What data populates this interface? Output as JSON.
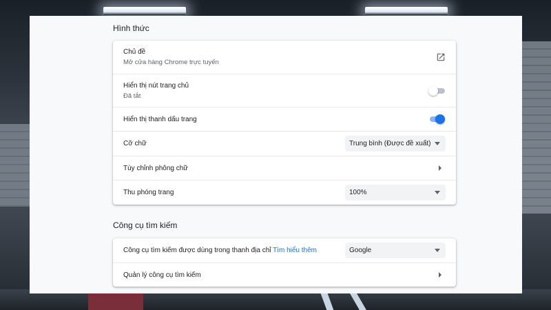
{
  "appearance": {
    "title": "Hình thức",
    "theme": {
      "label": "Chủ đề",
      "sublabel": "Mở cửa hàng Chrome trực tuyến",
      "icon": "external-link-icon"
    },
    "home_button": {
      "label": "Hiển thị nút trang chủ",
      "sublabel": "Đã tắt",
      "enabled": false
    },
    "bookmarks_bar": {
      "label": "Hiển thị thanh dấu trang",
      "enabled": true
    },
    "font_size": {
      "label": "Cỡ chữ",
      "value": "Trung bình (Được đề xuất)"
    },
    "customize_fonts": {
      "label": "Tùy chỉnh phông chữ"
    },
    "page_zoom": {
      "label": "Thu phóng trang",
      "value": "100%"
    }
  },
  "search_engine": {
    "title": "Công cụ tìm kiếm",
    "engine": {
      "label": "Công cụ tìm kiếm được dùng trong thanh địa chỉ",
      "link": "Tìm hiểu thêm",
      "value": "Google"
    },
    "manage": {
      "label": "Quản lý công cụ tìm kiếm"
    }
  },
  "colors": {
    "accent": "#1a73e8",
    "toggle_on_track": "#8ab4f8",
    "panel_bg": "#f8f9fa"
  }
}
